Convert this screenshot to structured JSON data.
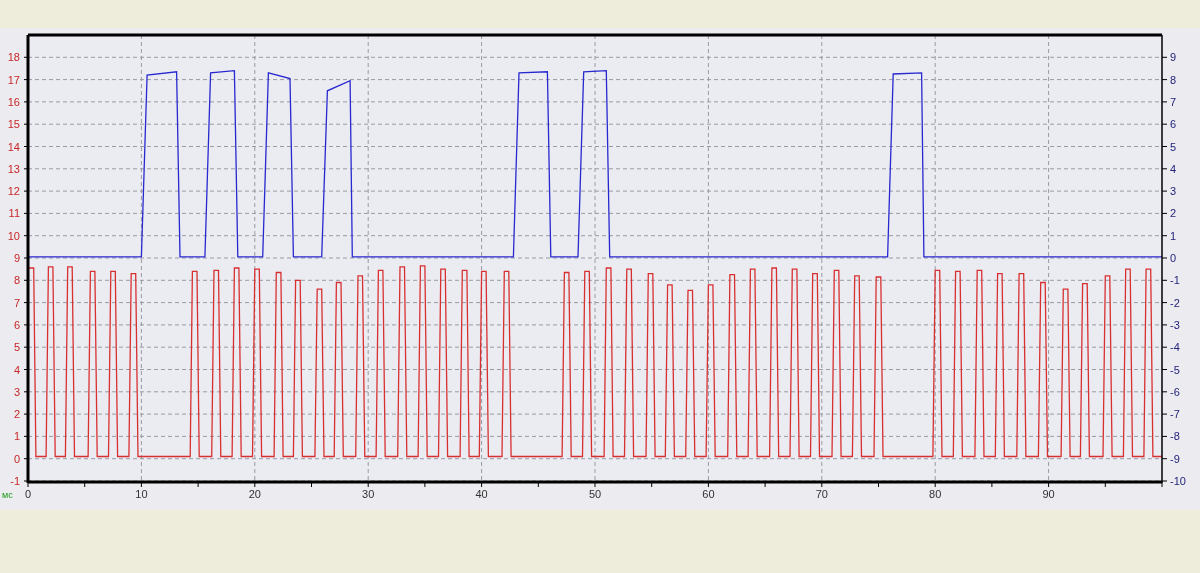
{
  "chart_data": {
    "type": "line",
    "xlabel": "мс",
    "grid": true,
    "xlim": [
      0,
      100
    ],
    "ylim": [
      -1,
      19
    ],
    "y2lim": [
      -10,
      10
    ],
    "xticks": [
      0,
      10,
      20,
      30,
      40,
      50,
      60,
      70,
      80,
      90
    ],
    "yticks": [
      -1,
      0,
      1,
      2,
      3,
      4,
      5,
      6,
      7,
      8,
      9,
      10,
      11,
      12,
      13,
      14,
      15,
      16,
      17,
      18
    ],
    "y2ticks": [
      -10,
      -9,
      -8,
      -7,
      -6,
      -5,
      -4,
      -3,
      -2,
      -1,
      0,
      1,
      2,
      3,
      4,
      5,
      6,
      7,
      8,
      9
    ],
    "series": [
      {
        "color": "#2828d0",
        "axis": "y2",
        "x": [
          0,
          10.0,
          10.5,
          13.1,
          13.4,
          15.6,
          16.1,
          18.2,
          18.5,
          20.7,
          21.2,
          23.1,
          23.4,
          25.9,
          26.4,
          28.4,
          28.6,
          42.8,
          43.3,
          45.8,
          46.1,
          48.5,
          49.0,
          51.0,
          51.3,
          75.8,
          76.3,
          78.8,
          79.0,
          100
        ],
        "values": [
          0.05,
          0.05,
          8.2,
          8.35,
          0.05,
          0.05,
          8.3,
          8.4,
          0.05,
          0.05,
          8.3,
          8.05,
          0.05,
          0.05,
          7.5,
          7.95,
          0.05,
          0.05,
          8.3,
          8.35,
          0.05,
          0.05,
          8.35,
          8.4,
          0.05,
          0.05,
          8.25,
          8.3,
          0.05,
          0.05
        ]
      },
      {
        "color": "#d83030",
        "x": [
          0,
          0.5,
          0.7,
          1.6,
          1.8,
          2.2,
          2.4,
          3.3,
          3.5,
          3.9,
          4.1,
          5.3,
          5.5,
          5.9,
          6.1,
          7.1,
          7.3,
          7.7,
          7.9,
          8.9,
          9.1,
          9.5,
          9.7,
          14.3,
          14.5,
          14.9,
          15.1,
          16.2,
          16.4,
          16.8,
          17.0,
          18.0,
          18.2,
          18.6,
          18.8,
          19.8,
          20.0,
          20.4,
          20.6,
          21.7,
          21.9,
          22.3,
          22.5,
          23.4,
          23.6,
          24.0,
          24.2,
          25.3,
          25.5,
          25.9,
          26.1,
          27.0,
          27.2,
          27.6,
          27.8,
          28.9,
          29.1,
          29.5,
          29.7,
          30.7,
          30.9,
          31.3,
          31.5,
          32.6,
          32.8,
          33.2,
          33.4,
          34.4,
          34.6,
          35.0,
          35.2,
          36.2,
          36.4,
          36.8,
          37.0,
          38.1,
          38.3,
          38.7,
          38.9,
          39.8,
          40.0,
          40.4,
          40.6,
          41.8,
          42.0,
          42.4,
          42.6,
          47.1,
          47.3,
          47.7,
          47.9,
          48.9,
          49.1,
          49.5,
          49.7,
          50.8,
          51.0,
          51.4,
          51.6,
          52.6,
          52.8,
          53.2,
          53.4,
          54.5,
          54.7,
          55.1,
          55.3,
          56.2,
          56.4,
          56.8,
          57.0,
          58.0,
          58.2,
          58.6,
          58.8,
          59.8,
          60.0,
          60.4,
          60.6,
          61.7,
          61.9,
          62.3,
          62.5,
          63.5,
          63.7,
          64.1,
          64.3,
          65.4,
          65.6,
          66.0,
          66.2,
          67.2,
          67.4,
          67.8,
          68.0,
          69.0,
          69.2,
          69.6,
          69.8,
          70.9,
          71.1,
          71.5,
          71.7,
          72.7,
          72.9,
          73.3,
          73.5,
          74.6,
          74.8,
          75.2,
          75.4,
          79.8,
          80.0,
          80.4,
          80.6,
          81.6,
          81.8,
          82.2,
          82.4,
          83.5,
          83.7,
          84.1,
          84.3,
          85.3,
          85.5,
          85.9,
          86.1,
          87.2,
          87.4,
          87.8,
          88.0,
          89.1,
          89.3,
          89.7,
          89.9,
          91.1,
          91.3,
          91.7,
          91.9,
          92.8,
          93.0,
          93.4,
          93.6,
          94.8,
          95.0,
          95.4,
          95.6,
          96.6,
          96.8,
          97.2,
          97.4,
          98.4,
          98.6,
          99.0,
          99.2,
          100
        ],
        "values": [
          8.55,
          8.55,
          0.1,
          0.1,
          8.6,
          8.6,
          0.1,
          0.1,
          8.6,
          8.6,
          0.1,
          0.1,
          8.4,
          8.4,
          0.1,
          0.1,
          8.4,
          8.4,
          0.1,
          0.1,
          8.3,
          8.3,
          0.1,
          0.1,
          8.4,
          8.4,
          0.1,
          0.1,
          8.45,
          8.45,
          0.1,
          0.1,
          8.55,
          8.55,
          0.1,
          0.1,
          8.5,
          8.5,
          0.1,
          0.1,
          8.35,
          8.35,
          0.1,
          0.1,
          8.0,
          8.0,
          0.1,
          0.1,
          7.6,
          7.6,
          0.1,
          0.1,
          7.9,
          7.9,
          0.1,
          0.1,
          8.2,
          8.2,
          0.1,
          0.1,
          8.45,
          8.45,
          0.1,
          0.1,
          8.6,
          8.6,
          0.1,
          0.1,
          8.65,
          8.65,
          0.1,
          0.1,
          8.5,
          8.5,
          0.1,
          0.1,
          8.45,
          8.45,
          0.1,
          0.1,
          8.4,
          8.4,
          0.1,
          0.1,
          8.4,
          8.4,
          0.1,
          0.1,
          8.35,
          8.35,
          0.1,
          0.1,
          8.4,
          8.4,
          0.1,
          0.1,
          8.55,
          8.55,
          0.1,
          0.1,
          8.5,
          8.5,
          0.1,
          0.1,
          8.3,
          8.3,
          0.1,
          0.1,
          7.8,
          7.8,
          0.1,
          0.1,
          7.55,
          7.55,
          0.1,
          0.1,
          7.8,
          7.8,
          0.1,
          0.1,
          8.25,
          8.25,
          0.1,
          0.1,
          8.5,
          8.5,
          0.1,
          0.1,
          8.55,
          8.55,
          0.1,
          0.1,
          8.5,
          8.5,
          0.1,
          0.1,
          8.3,
          8.3,
          0.1,
          0.1,
          8.45,
          8.45,
          0.1,
          0.1,
          8.2,
          8.2,
          0.1,
          0.1,
          8.15,
          8.15,
          0.1,
          0.1,
          8.45,
          8.45,
          0.1,
          0.1,
          8.4,
          8.4,
          0.1,
          0.1,
          8.45,
          8.45,
          0.1,
          0.1,
          8.3,
          8.3,
          0.1,
          0.1,
          8.3,
          8.3,
          0.1,
          0.1,
          7.9,
          7.9,
          0.1,
          0.1,
          7.6,
          7.6,
          0.1,
          0.1,
          7.85,
          7.85,
          0.1,
          0.1,
          8.2,
          8.2,
          0.1,
          0.1,
          8.5,
          8.5,
          0.1,
          0.1,
          8.5,
          8.5,
          0.1,
          0.1
        ]
      }
    ]
  }
}
